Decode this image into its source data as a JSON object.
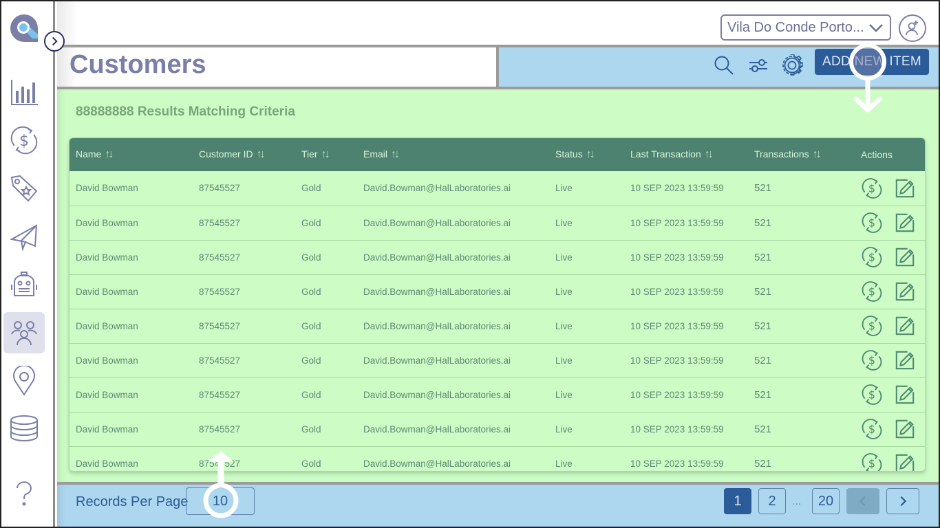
{
  "app": {
    "logo": "search-logo",
    "collapse_button": "chevron-right-icon"
  },
  "sidebar": {
    "items": [
      {
        "name": "analytics",
        "icon": "bar-chart-icon",
        "active": false
      },
      {
        "name": "transactions",
        "icon": "dollar-refresh-icon",
        "active": false
      },
      {
        "name": "promotions",
        "icon": "tag-star-icon",
        "active": false
      },
      {
        "name": "campaigns",
        "icon": "paper-plane-icon",
        "active": false
      },
      {
        "name": "automation",
        "icon": "robot-icon",
        "active": false
      },
      {
        "name": "customers",
        "icon": "users-icon",
        "active": true
      },
      {
        "name": "locations",
        "icon": "map-pin-icon",
        "active": false
      },
      {
        "name": "database",
        "icon": "database-icon",
        "active": false
      },
      {
        "name": "help",
        "icon": "question-icon",
        "active": false
      }
    ]
  },
  "header": {
    "location_select": "Vila Do Conde Porto...",
    "user_button_icon": "user-add-icon"
  },
  "page": {
    "title": "Customers",
    "tools": [
      "search-icon",
      "filter-sliders-icon",
      "gear-icon"
    ],
    "add_button": "ADD NEW ITEM"
  },
  "results": {
    "summary": "88888888 Results Matching Criteria"
  },
  "table": {
    "sort_glyph": "↑↓",
    "columns": [
      "Name",
      "Customer ID",
      "Tier",
      "Email",
      "Status",
      "Last Transaction",
      "Transactions",
      "Actions"
    ],
    "rows": [
      {
        "name": "David Bowman",
        "customer_id": "87545527",
        "tier": "Gold",
        "email": "David.Bowman@HalLaboratories.ai",
        "status": "Live",
        "last_transaction": "10 SEP 2023  13:59:59",
        "transactions": "521"
      },
      {
        "name": "David Bowman",
        "customer_id": "87545527",
        "tier": "Gold",
        "email": "David.Bowman@HalLaboratories.ai",
        "status": "Live",
        "last_transaction": "10 SEP 2023  13:59:59",
        "transactions": "521"
      },
      {
        "name": "David Bowman",
        "customer_id": "87545527",
        "tier": "Gold",
        "email": "David.Bowman@HalLaboratories.ai",
        "status": "Live",
        "last_transaction": "10 SEP 2023  13:59:59",
        "transactions": "521"
      },
      {
        "name": "David Bowman",
        "customer_id": "87545527",
        "tier": "Gold",
        "email": "David.Bowman@HalLaboratories.ai",
        "status": "Live",
        "last_transaction": "10 SEP 2023  13:59:59",
        "transactions": "521"
      },
      {
        "name": "David Bowman",
        "customer_id": "87545527",
        "tier": "Gold",
        "email": "David.Bowman@HalLaboratories.ai",
        "status": "Live",
        "last_transaction": "10 SEP 2023  13:59:59",
        "transactions": "521"
      },
      {
        "name": "David Bowman",
        "customer_id": "87545527",
        "tier": "Gold",
        "email": "David.Bowman@HalLaboratories.ai",
        "status": "Live",
        "last_transaction": "10 SEP 2023  13:59:59",
        "transactions": "521"
      },
      {
        "name": "David Bowman",
        "customer_id": "87545527",
        "tier": "Gold",
        "email": "David.Bowman@HalLaboratories.ai",
        "status": "Live",
        "last_transaction": "10 SEP 2023  13:59:59",
        "transactions": "521"
      },
      {
        "name": "David Bowman",
        "customer_id": "87545527",
        "tier": "Gold",
        "email": "David.Bowman@HalLaboratories.ai",
        "status": "Live",
        "last_transaction": "10 SEP 2023  13:59:59",
        "transactions": "521"
      },
      {
        "name": "David Bowman",
        "customer_id": "87545527",
        "tier": "Gold",
        "email": "David.Bowman@HalLaboratories.ai",
        "status": "Live",
        "last_transaction": "10 SEP 2023  13:59:59",
        "transactions": "521"
      }
    ],
    "row_actions": [
      "dollar-refresh-icon",
      "edit-icon"
    ]
  },
  "footer": {
    "records_per_page_label": "Records Per Page",
    "records_per_page_value": "10",
    "pages": [
      "1",
      "2",
      "20"
    ],
    "current_page": "1",
    "ellipsis": "...",
    "prev_icon": "chevron-left-icon",
    "next_icon": "chevron-right-icon"
  },
  "colors": {
    "accent": "#2c5b9a",
    "table_header": "#4d8270",
    "main_bg": "#cdfcc5",
    "toolbar_bg": "#add6ef",
    "sidebar_icon": "#7b7fa8"
  }
}
